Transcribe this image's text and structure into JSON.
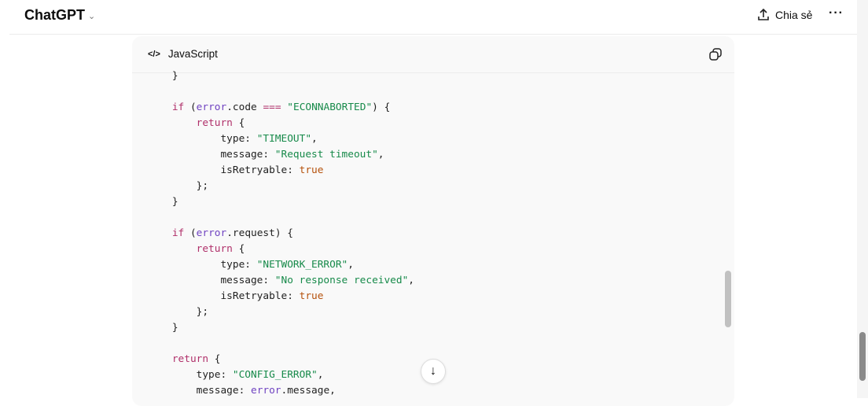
{
  "header": {
    "title": "ChatGPT",
    "share_label": "Chia sẻ",
    "more_label": "···"
  },
  "code_block": {
    "language": "JavaScript",
    "lines": [
      [
        [
          "    }",
          ""
        ]
      ],
      [],
      [
        [
          "    ",
          ""
        ],
        [
          "if",
          "kw"
        ],
        [
          " (",
          ""
        ],
        [
          "error",
          "var"
        ],
        [
          ".code ",
          ""
        ],
        [
          "===",
          "op"
        ],
        [
          " ",
          ""
        ],
        [
          "\"ECONNABORTED\"",
          "str"
        ],
        [
          ") {",
          ""
        ]
      ],
      [
        [
          "        ",
          ""
        ],
        [
          "return",
          "kw"
        ],
        [
          " {",
          ""
        ]
      ],
      [
        [
          "            type: ",
          ""
        ],
        [
          "\"TIMEOUT\"",
          "str"
        ],
        [
          ",",
          ""
        ]
      ],
      [
        [
          "            message: ",
          ""
        ],
        [
          "\"Request timeout\"",
          "str"
        ],
        [
          ",",
          ""
        ]
      ],
      [
        [
          "            isRetryable: ",
          ""
        ],
        [
          "true",
          "bool"
        ]
      ],
      [
        [
          "        };",
          ""
        ]
      ],
      [
        [
          "    }",
          ""
        ]
      ],
      [],
      [
        [
          "    ",
          ""
        ],
        [
          "if",
          "kw"
        ],
        [
          " (",
          ""
        ],
        [
          "error",
          "var"
        ],
        [
          ".request) {",
          ""
        ]
      ],
      [
        [
          "        ",
          ""
        ],
        [
          "return",
          "kw"
        ],
        [
          " {",
          ""
        ]
      ],
      [
        [
          "            type: ",
          ""
        ],
        [
          "\"NETWORK_ERROR\"",
          "str"
        ],
        [
          ",",
          ""
        ]
      ],
      [
        [
          "            message: ",
          ""
        ],
        [
          "\"No response received\"",
          "str"
        ],
        [
          ",",
          ""
        ]
      ],
      [
        [
          "            isRetryable: ",
          ""
        ],
        [
          "true",
          "bool"
        ]
      ],
      [
        [
          "        };",
          ""
        ]
      ],
      [
        [
          "    }",
          ""
        ]
      ],
      [],
      [
        [
          "    ",
          ""
        ],
        [
          "return",
          "kw"
        ],
        [
          " {",
          ""
        ]
      ],
      [
        [
          "        type: ",
          ""
        ],
        [
          "\"CONFIG_ERROR\"",
          "str"
        ],
        [
          ",",
          ""
        ]
      ],
      [
        [
          "        message: ",
          ""
        ],
        [
          "error",
          "var"
        ],
        [
          ".message,",
          ""
        ]
      ]
    ]
  }
}
